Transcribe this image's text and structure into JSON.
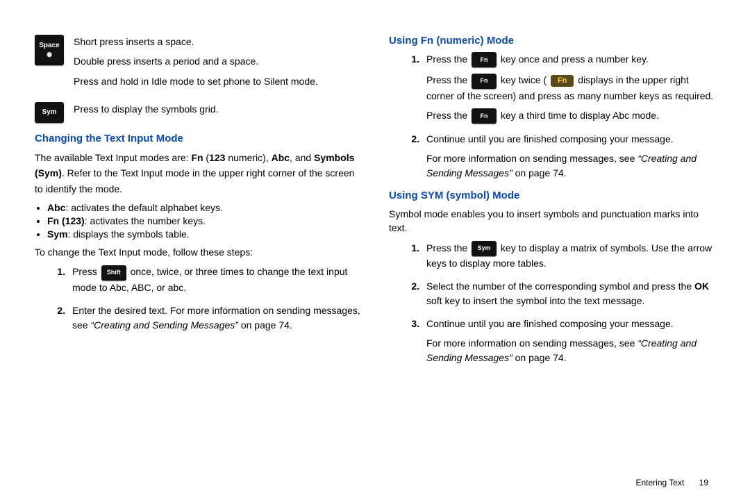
{
  "left": {
    "space": {
      "key": "Space",
      "p1": "Short press inserts a space.",
      "p2": "Double press inserts a period and a space.",
      "p3": "Press and hold in Idle mode to set phone to Silent mode."
    },
    "sym": {
      "key": "Sym",
      "p": "Press to display the symbols grid."
    },
    "h1": "Changing the Text Input Mode",
    "intro1a": "The available Text Input modes are: ",
    "intro1b": "Fn",
    "intro1c": " (",
    "intro1d": "123",
    "intro1e": " numeric), ",
    "intro1f": "Abc",
    "intro1g": ", and ",
    "intro1h": "Symbols (Sym)",
    "intro1i": ". Refer to the Text Input mode in the upper right corner of the screen to identify the mode.",
    "b1a": "Abc",
    "b1b": ": activates the default alphabet keys.",
    "b2a": "Fn (123)",
    "b2b": ": activates the number keys.",
    "b3a": "Sym",
    "b3b": ": displays the symbols table.",
    "intro2": "To change the Text Input mode, follow these steps:",
    "step1a": "Press ",
    "step1key": "Shift",
    "step1b": " once, twice, or three times to change the text input mode to Abc, ABC, or abc.",
    "step2a": "Enter the desired text. For more information on sending messages, see ",
    "step2b": "“Creating and Sending Messages”",
    "step2c": " on page 74."
  },
  "right": {
    "h1": "Using Fn (numeric) Mode",
    "s1a": "Press the ",
    "fnkey": "Fn",
    "s1b": " key once and press a number key.",
    "s1c": "Press the ",
    "s1d": " key twice ( ",
    "fnbadge": "Fn",
    "s1e": " displays in the upper right corner of the screen) and press as many number keys as required.",
    "s1f": "Press the ",
    "s1g": " key a third time to display Abc mode.",
    "s2": "Continue until you are finished composing your message.",
    "s2b": "For more information on sending messages, see ",
    "s2c": "“Creating and Sending Messages”",
    "s2d": " on page 74.",
    "h2": "Using SYM (symbol) Mode",
    "intro": "Symbol mode enables you to insert symbols and punctuation marks into text.",
    "t1a": "Press the ",
    "symkey": "Sym",
    "t1b": " key to display a matrix of symbols. Use the arrow keys to display more tables.",
    "t2a": "Select the number of the corresponding symbol and press the ",
    "t2b": "OK",
    "t2c": " soft key to insert the symbol into the text message.",
    "t3": "Continue until you are finished composing your message.",
    "t3b": "For more information on sending messages, see ",
    "t3c": "“Creating and Sending Messages”",
    "t3d": " on page 74."
  },
  "footer": {
    "section": "Entering Text",
    "page": "19"
  }
}
